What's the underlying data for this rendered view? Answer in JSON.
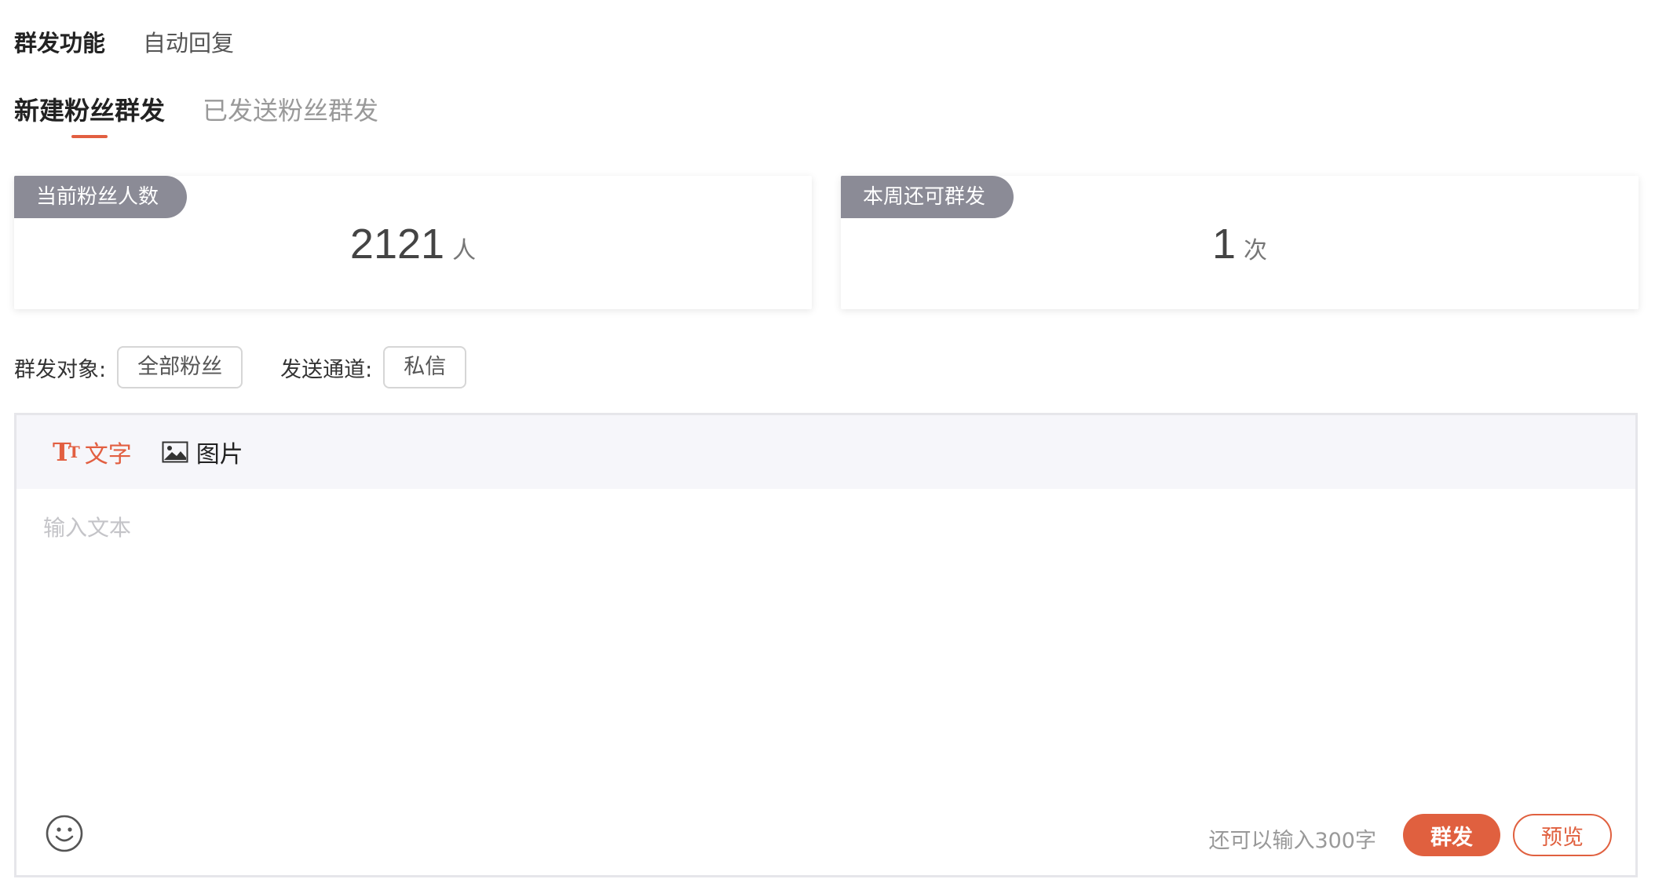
{
  "top_nav": {
    "items": [
      {
        "label": "群发功能",
        "active": true
      },
      {
        "label": "自动回复",
        "active": false
      }
    ]
  },
  "sub_tabs": {
    "items": [
      {
        "label": "新建粉丝群发",
        "active": true
      },
      {
        "label": "已发送粉丝群发",
        "active": false
      }
    ]
  },
  "stats": {
    "fans": {
      "label": "当前粉丝人数",
      "value": "2121",
      "unit": "人"
    },
    "remaining": {
      "label": "本周还可群发",
      "value": "1",
      "unit": "次"
    }
  },
  "target": {
    "audience_label": "群发对象:",
    "audience_value": "全部粉丝",
    "channel_label": "发送通道:",
    "channel_value": "私信"
  },
  "editor": {
    "tools": {
      "text": "文字",
      "image": "图片"
    },
    "placeholder": "输入文本",
    "counter": "还可以输入300字",
    "send_label": "群发",
    "preview_label": "预览"
  },
  "colors": {
    "accent": "#e0603f",
    "tag_bg": "#8b8b96",
    "toolbar_bg": "#f6f6fa"
  },
  "icons": {
    "text_tool": "text-format-icon",
    "image_tool": "image-icon",
    "emoji": "smiley-icon"
  }
}
